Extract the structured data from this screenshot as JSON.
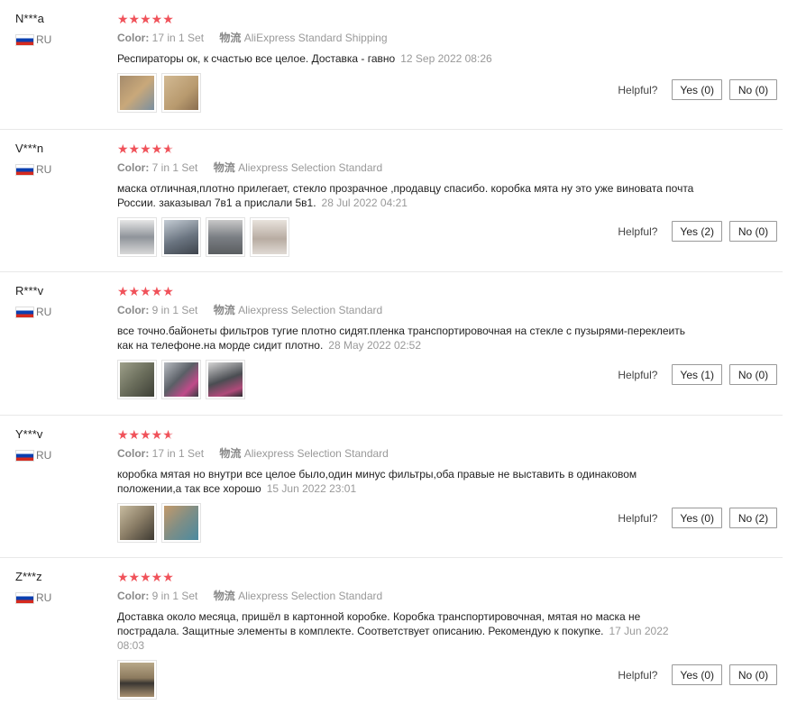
{
  "labels": {
    "color": "Color:",
    "shipping": "物流",
    "helpful": "Helpful?"
  },
  "reviews": [
    {
      "user": "N***a",
      "country": "RU",
      "stars_full": "★★★★★",
      "stars_half": "",
      "color": "17 in 1 Set",
      "shipping": "AliExpress Standard Shipping",
      "text": "Респираторы ок, к счастью все целое. Доставка - гавно",
      "date": "12 Sep 2022 08:26",
      "thumbs": [
        "#c9a87a",
        "#b89a6e"
      ],
      "yes": "Yes (0)",
      "no": "No (0)"
    },
    {
      "user": "V***n",
      "country": "RU",
      "stars_full": "★★★★",
      "stars_half": "★",
      "color": "7 in 1 Set",
      "shipping": "Aliexpress Selection Standard",
      "text": "маска отличная,плотно прилегает, стекло прозрачное ,продавцу спасибо. коробка мята ну это уже виновата почта России. заказывал 7в1 а прислали 5в1.",
      "date": "28 Jul 2022 04:21",
      "thumbs": [
        "#8f949a",
        "#6a7480",
        "#7b7f84",
        "#b8aca2"
      ],
      "yes": "Yes (2)",
      "no": "No (0)"
    },
    {
      "user": "R***v",
      "country": "RU",
      "stars_full": "★★★★★",
      "stars_half": "",
      "color": "9 in 1 Set",
      "shipping": "Aliexpress Selection Standard",
      "text": "все точно.байонеты фильтров тугие плотно сидят.пленка транспортировочная на стекле с пузырями-переклеить как на телефоне.на морде сидит плотно.",
      "date": "28 May 2022 02:52",
      "thumbs": [
        "#6b6e5c",
        "#5a5f66",
        "#4a4d52"
      ],
      "yes": "Yes (1)",
      "no": "No (0)"
    },
    {
      "user": "Y***v",
      "country": "RU",
      "stars_full": "★★★★",
      "stars_half": "★",
      "color": "17 in 1 Set",
      "shipping": "Aliexpress Selection Standard",
      "text": "коробка мятая но внутри все целое было,один минус фильтры,оба правые не выставить в одинаковом положении,а так все хорошо",
      "date": "15 Jun 2022 23:01",
      "thumbs": [
        "#8a7d66",
        "#7e8e86"
      ],
      "yes": "Yes (0)",
      "no": "No (2)"
    },
    {
      "user": "Z***z",
      "country": "RU",
      "stars_full": "★★★★★",
      "stars_half": "",
      "color": "9 in 1 Set",
      "shipping": "Aliexpress Selection Standard",
      "text": "Доставка около месяца, пришёл в картонной коробке. Коробка транспортировочная, мятая но маска не пострадала. Защитные элементы в комплекте. Соответствует описанию. Рекомендую к покупке.",
      "date": "17 Jun 2022 08:03",
      "thumbs": [
        "#8c7a5e"
      ],
      "yes": "Yes (0)",
      "no": "No (0)"
    }
  ]
}
